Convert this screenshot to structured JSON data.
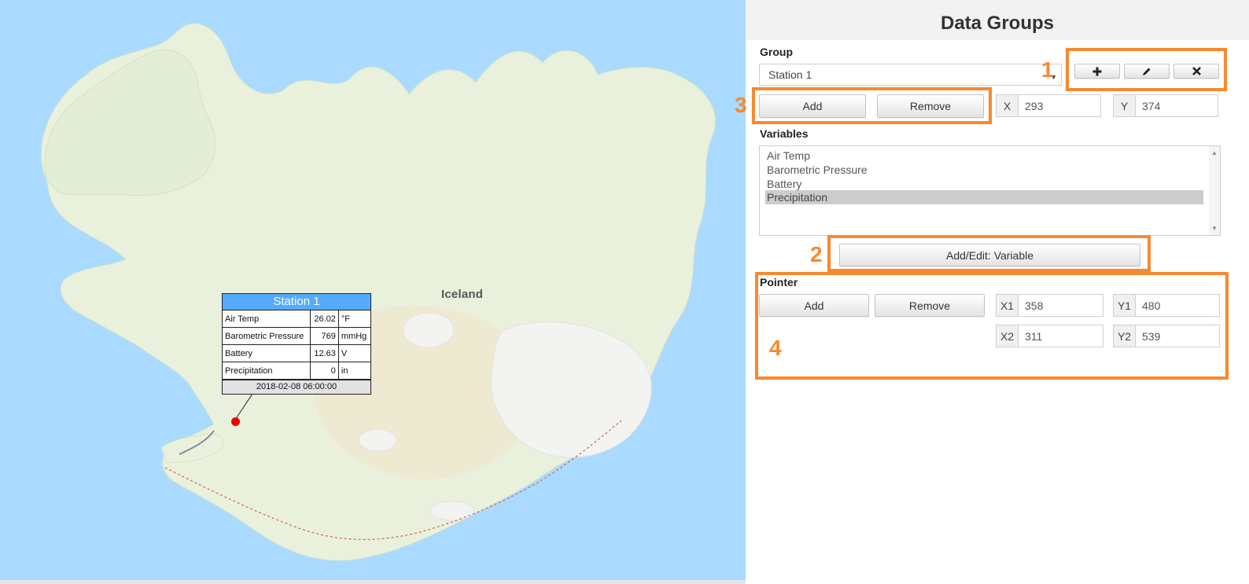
{
  "map": {
    "place_label": "Iceland",
    "popup": {
      "title": "Station 1",
      "rows": [
        {
          "name": "Air Temp",
          "value": "26.02",
          "unit": "°F"
        },
        {
          "name": "Barometric Pressure",
          "value": "769",
          "unit": "mmHg"
        },
        {
          "name": "Battery",
          "value": "12.63",
          "unit": "V"
        },
        {
          "name": "Precipitation",
          "value": "0",
          "unit": "in"
        }
      ],
      "timestamp": "2018-02-08 06:00:00"
    }
  },
  "panel": {
    "title": "Data Groups",
    "group": {
      "label": "Group",
      "selected": "Station 1",
      "icons": [
        "plus-icon",
        "pencil-icon",
        "close-icon"
      ],
      "add_label": "Add",
      "remove_label": "Remove",
      "x_label": "X",
      "x_value": "293",
      "y_label": "Y",
      "y_value": "374"
    },
    "variables": {
      "label": "Variables",
      "items": [
        "Air Temp",
        "Barometric Pressure",
        "Battery",
        "Precipitation"
      ],
      "selected": "Precipitation",
      "add_edit_label": "Add/Edit: Variable"
    },
    "pointer": {
      "label": "Pointer",
      "add_label": "Add",
      "remove_label": "Remove",
      "x1_label": "X1",
      "x1_value": "358",
      "y1_label": "Y1",
      "y1_value": "480",
      "x2_label": "X2",
      "x2_value": "311",
      "y2_label": "Y2",
      "y2_value": "539"
    }
  },
  "annotations": [
    "1",
    "2",
    "3",
    "4"
  ],
  "colors": {
    "ocean": "#aadaff",
    "land": "#eaf1dd",
    "popup_header": "#55aaff",
    "highlight": "#f7892e",
    "marker": "#ee0000"
  }
}
